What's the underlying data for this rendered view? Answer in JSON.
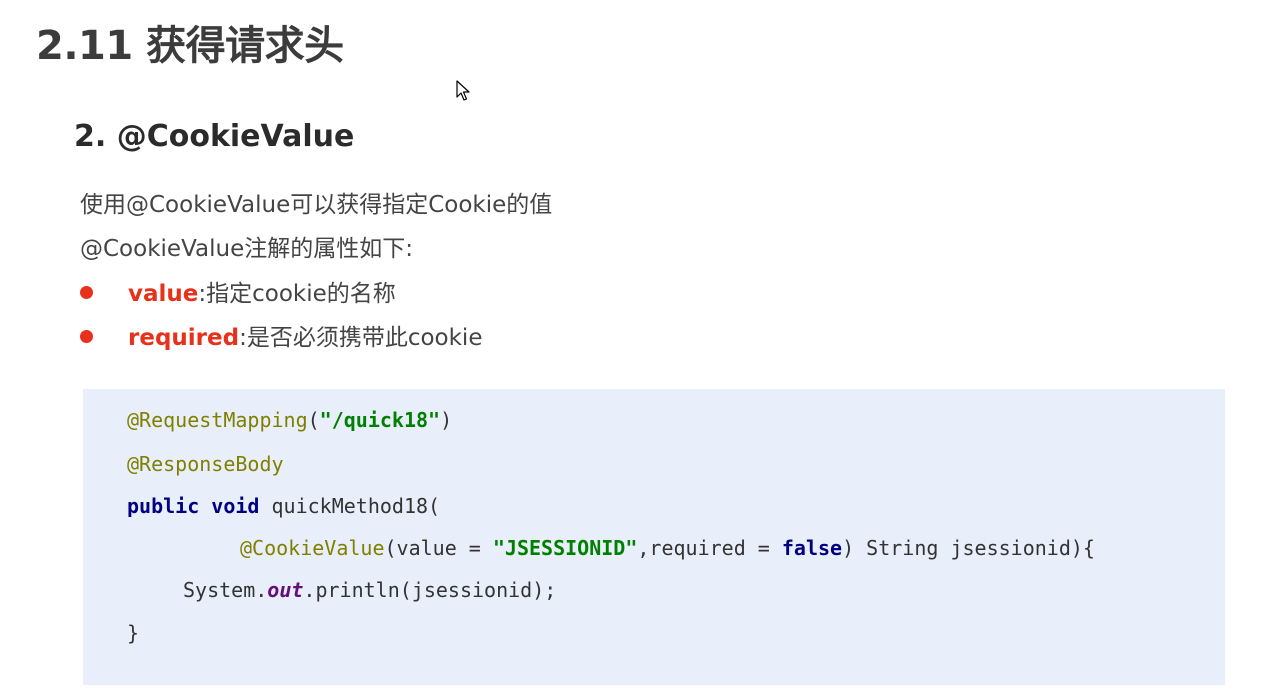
{
  "slide": {
    "title": "2.11 获得请求头",
    "section_heading": "2. @CookieValue"
  },
  "intro": {
    "line1": "使用@CookieValue可以获得指定Cookie的值",
    "line2": "@CookieValue注解的属性如下:"
  },
  "attributes": [
    {
      "name": "value",
      "sep": ":",
      "desc": "指定cookie的名称"
    },
    {
      "name": "required",
      "sep": ":",
      "desc": "是否必须携带此cookie"
    }
  ],
  "code": {
    "l1_annot": "@RequestMapping",
    "l1_open": "(",
    "l1_str": "\"/quick18\"",
    "l1_close": ")",
    "l2_annot": "@ResponseBody",
    "l3_kw1": "public",
    "l3_sp1": " ",
    "l3_kw2": "void",
    "l3_rest": " quickMethod18(",
    "l4_annot": "@CookieValue",
    "l4_a": "(value = ",
    "l4_str": "\"JSESSIONID\"",
    "l4_b": ",required = ",
    "l4_kw": "false",
    "l4_c": ") String jsessionid){",
    "l5_a": "System.",
    "l5_field": "out",
    "l5_b": ".println(jsessionid);",
    "l6": "}"
  },
  "colors": {
    "accent_red": "#e8311a",
    "code_bg": "#e8eefa",
    "annotation": "#808000",
    "string": "#008000",
    "keyword": "#000080",
    "static_field": "#660e7a"
  },
  "icons": {
    "cursor": "mouse-pointer-icon"
  }
}
